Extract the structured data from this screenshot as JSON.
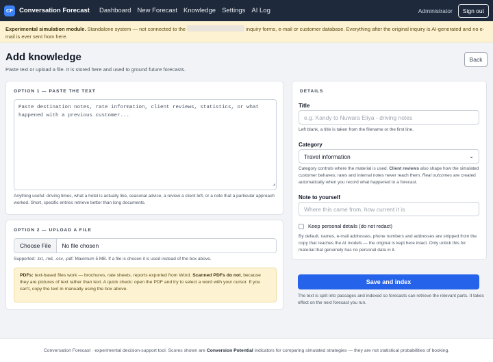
{
  "app": {
    "logo": "CF",
    "name": "Conversation Forecast"
  },
  "nav": {
    "items": [
      "Dashboard",
      "New Forecast",
      "Knowledge",
      "Settings",
      "AI Log"
    ]
  },
  "user": {
    "name": "Administrator",
    "signout": "Sign out"
  },
  "banner": {
    "bold": "Experimental simulation module.",
    "pre": "Standalone system — not connected to the",
    "post": "inquiry forms, e-mail or customer database. Everything after the original inquiry is AI-generated and no e-mail is ever sent from here."
  },
  "page": {
    "title": "Add knowledge",
    "subtitle": "Paste text or upload a file. It is stored here and used to ground future forecasts.",
    "back": "Back"
  },
  "option1": {
    "heading": "OPTION 1 — PASTE THE TEXT",
    "placeholder": "Paste destination notes, rate information, client reviews, statistics, or what happened with a previous customer...",
    "help": "Anything useful: driving times, what a hotel is actually like, seasonal advice, a review a client left, or a note that a particular approach worked. Short, specific entries retrieve better than long documents."
  },
  "option2": {
    "heading": "OPTION 2 — UPLOAD A FILE",
    "choose": "Choose File",
    "no_file": "No file chosen",
    "supported": "Supported: .txt, .md, .csv, .pdf. Maximum 5 MB. If a file is chosen it is used instead of the box above.",
    "note": {
      "b1": "PDFs:",
      "t1": " text-based files work — brochures, rate sheets, reports exported from Word. ",
      "b2": "Scanned PDFs do not",
      "t2": ", because they are pictures of text rather than text. A quick check: open the PDF and try to select a word with your cursor. If you can't, copy the text in manually using the box above."
    }
  },
  "details": {
    "heading": "DETAILS",
    "title_label": "Title",
    "title_placeholder": "e.g. Kandy to Nuwara Eliya - driving notes",
    "title_help": "Left blank, a title is taken from the filename or the first line.",
    "category_label": "Category",
    "category_value": "Travel information",
    "category_help": {
      "t1": "Category controls where the material is used. ",
      "b1": "Client reviews",
      "t2": " also shape how the simulated customer behaves; rates and internal notes never reach them. ",
      "i1": "Real outcomes",
      "t3": " are created automatically when you record what happened to a forecast."
    },
    "note_label": "Note to yourself",
    "note_placeholder": "Where this came from, how current it is",
    "keep_label": "Keep personal details (do not redact)",
    "keep_help": "By default, names, e-mail addresses, phone numbers and addresses are stripped from the copy that reaches the AI models — the original is kept here intact. Only untick this for material that genuinely has no personal data in it."
  },
  "save": {
    "label": "Save and index",
    "help": "The text is split into passages and indexed so forecasts can retrieve the relevant parts. It takes effect on the next forecast you run."
  },
  "footer": {
    "pre": "Conversation Forecast · experimental decision-support tool. Scores shown are ",
    "bold": "Conversion Potential",
    "post": " indicators for comparing simulated strategies — they are not statistical probabilities of booking."
  }
}
